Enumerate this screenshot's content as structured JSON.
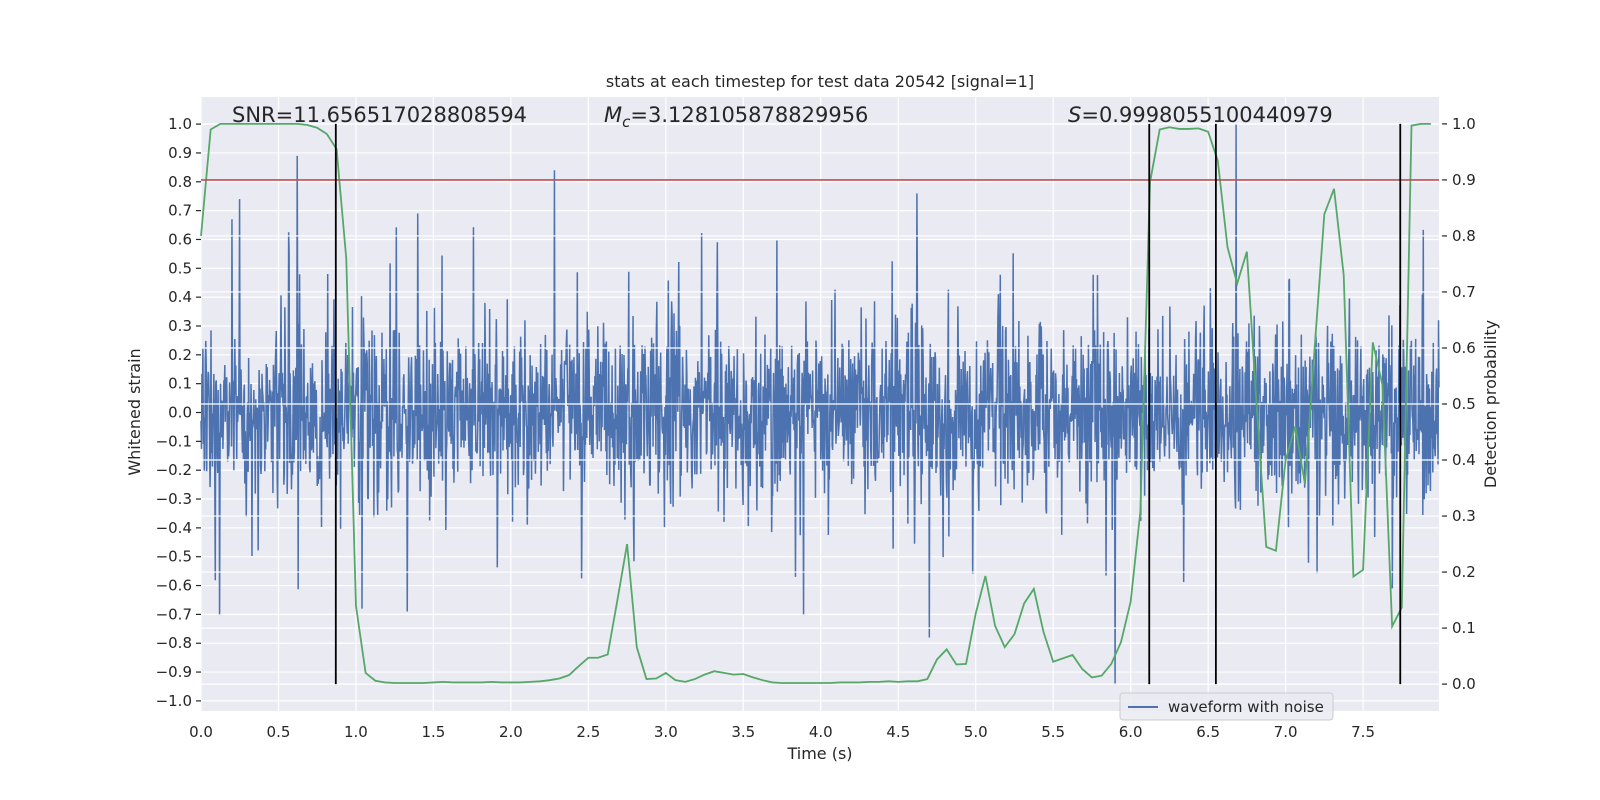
{
  "chart_data": {
    "type": "line",
    "title": "stats at each timestep for test data 20542 [signal=1]",
    "xlabel": "Time (s)",
    "ylabel_left": "Whitened strain",
    "ylabel_right": "Detection probability",
    "xlim": [
      0,
      7.99
    ],
    "ylim_left": [
      -1.035,
      1.094
    ],
    "ylim_right": [
      -0.048,
      1.048
    ],
    "grid": true,
    "legend_placement": "lower-right",
    "x_ticks": [
      "0.0",
      "0.5",
      "1.0",
      "1.5",
      "2.0",
      "2.5",
      "3.0",
      "3.5",
      "4.0",
      "4.5",
      "5.0",
      "5.5",
      "6.0",
      "6.5",
      "7.0",
      "7.5"
    ],
    "x_tick_values": [
      0,
      0.5,
      1,
      1.5,
      2,
      2.5,
      3,
      3.5,
      4,
      4.5,
      5,
      5.5,
      6,
      6.5,
      7,
      7.5
    ],
    "y_left_ticks": [
      "1.0",
      "0.9",
      "0.8",
      "0.7",
      "0.6",
      "0.5",
      "0.4",
      "0.3",
      "0.2",
      "0.1",
      "0.0",
      "−0.1",
      "−0.2",
      "−0.3",
      "−0.4",
      "−0.5",
      "−0.6",
      "−0.7",
      "−0.8",
      "−0.9",
      "−1.0"
    ],
    "y_left_tick_values": [
      1,
      0.9,
      0.8,
      0.7,
      0.6,
      0.5,
      0.4,
      0.3,
      0.2,
      0.1,
      0,
      -0.1,
      -0.2,
      -0.3,
      -0.4,
      -0.5,
      -0.6,
      -0.7,
      -0.8,
      -0.9,
      -1
    ],
    "y_right_ticks": [
      "1.0",
      "0.9",
      "0.8",
      "0.7",
      "0.6",
      "0.5",
      "0.4",
      "0.3",
      "0.2",
      "0.1",
      "0.0"
    ],
    "y_right_tick_values": [
      1,
      0.9,
      0.8,
      0.7,
      0.6,
      0.5,
      0.4,
      0.3,
      0.2,
      0.1,
      0
    ],
    "annotations": {
      "snr": "SNR=11.656517028808594",
      "mc_symbol": "M",
      "mc_sub": "c",
      "mc_value": "=3.128105878829956",
      "s_symbol": "S",
      "s_value": "=0.9998055100440979"
    },
    "series": [
      {
        "name": "waveform with noise",
        "axis": "left",
        "color": "#4c72b0",
        "approx_std": 0.15,
        "notable_peaks": [
          {
            "t": 0.12,
            "y": -0.7
          },
          {
            "t": 0.2,
            "y": 0.67
          },
          {
            "t": 0.25,
            "y": 0.74
          },
          {
            "t": 0.62,
            "y": 0.89
          },
          {
            "t": 1.04,
            "y": -0.68
          },
          {
            "t": 1.4,
            "y": 0.69
          },
          {
            "t": 1.33,
            "y": -0.69
          },
          {
            "t": 2.28,
            "y": 0.84
          },
          {
            "t": 3.89,
            "y": -0.7
          },
          {
            "t": 4.62,
            "y": 0.76
          },
          {
            "t": 4.7,
            "y": -0.78
          },
          {
            "t": 5.9,
            "y": -0.94
          },
          {
            "t": 6.68,
            "y": 1.0
          },
          {
            "t": 7.69,
            "y": -0.61
          }
        ]
      },
      {
        "axis": "right",
        "color": "#55a868",
        "t_step": 0.0625,
        "values": [
          0.8,
          0.99,
          1.0,
          1.0,
          1.0,
          1.0,
          1.0,
          1.0,
          1.0,
          1.0,
          1.0,
          0.998,
          0.993,
          0.982,
          0.955,
          0.76,
          0.14,
          0.02,
          0.006,
          0.003,
          0.002,
          0.002,
          0.002,
          0.002,
          0.003,
          0.004,
          0.003,
          0.003,
          0.003,
          0.003,
          0.004,
          0.003,
          0.003,
          0.003,
          0.004,
          0.005,
          0.007,
          0.01,
          0.016,
          0.032,
          0.047,
          0.047,
          0.053,
          0.15,
          0.25,
          0.066,
          0.009,
          0.01,
          0.02,
          0.007,
          0.004,
          0.009,
          0.017,
          0.023,
          0.02,
          0.017,
          0.018,
          0.012,
          0.007,
          0.003,
          0.002,
          0.002,
          0.002,
          0.002,
          0.002,
          0.002,
          0.003,
          0.003,
          0.003,
          0.004,
          0.004,
          0.005,
          0.004,
          0.005,
          0.005,
          0.009,
          0.044,
          0.062,
          0.035,
          0.036,
          0.126,
          0.193,
          0.104,
          0.066,
          0.089,
          0.144,
          0.17,
          0.093,
          0.04,
          0.046,
          0.052,
          0.027,
          0.012,
          0.015,
          0.036,
          0.075,
          0.147,
          0.308,
          0.896,
          0.99,
          0.994,
          0.991,
          0.991,
          0.992,
          0.986,
          0.934,
          0.78,
          0.715,
          0.772,
          0.5,
          0.245,
          0.238,
          0.4,
          0.46,
          0.357,
          0.6,
          0.839,
          0.884,
          0.73,
          0.192,
          0.204,
          0.61,
          0.534,
          0.103,
          0.137,
          0.997,
          1.0,
          1.0
        ]
      }
    ],
    "threshold": {
      "axis": "right",
      "value": 0.9,
      "color": "#c44e52"
    },
    "vlines": {
      "axis": "right",
      "t": [
        0.87,
        6.12,
        6.55,
        7.74
      ],
      "ymin": 0,
      "ymax": 1,
      "color": "#000000"
    },
    "legend": {
      "entries": [
        "waveform with noise"
      ]
    },
    "colors": {
      "background": "#eaeaf2",
      "grid": "#ffffff"
    }
  }
}
